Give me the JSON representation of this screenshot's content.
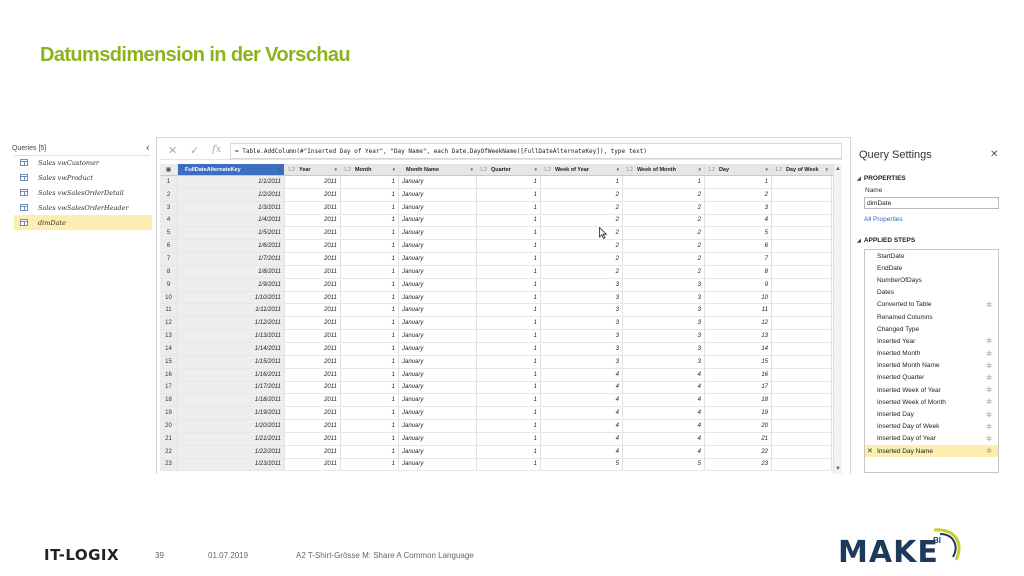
{
  "slide": {
    "title": "Datumsdimension in der Vorschau"
  },
  "queries": {
    "header": "Queries [5]",
    "collapse_icon": "chevron-left",
    "items": [
      {
        "label": "Sales vwCustomer"
      },
      {
        "label": "Sales vwProduct"
      },
      {
        "label": "Sales vwSalesOrderDetail"
      },
      {
        "label": "Sales vwSalesOrderHeader"
      },
      {
        "label": "dimDate",
        "selected": true
      }
    ]
  },
  "formula": {
    "cancel_glyph": "✕",
    "commit_glyph": "✓",
    "fx_label": "fx",
    "text": "= Table.AddColumn(#\"Inserted Day of Year\", \"Day Name\", each Date.DayOfWeekName([FullDateAlternateKey]), type text)"
  },
  "grid": {
    "columns": [
      {
        "type": "",
        "name": "FullDateAlternateKey",
        "selected": true
      },
      {
        "type": "1.2",
        "name": "Year"
      },
      {
        "type": "1.2",
        "name": "Month"
      },
      {
        "type": "",
        "name": "Month Name"
      },
      {
        "type": "1.2",
        "name": "Quarter"
      },
      {
        "type": "1.2",
        "name": "Week of Year"
      },
      {
        "type": "1.2",
        "name": "Week of Month"
      },
      {
        "type": "1.2",
        "name": "Day"
      },
      {
        "type": "1.2",
        "name": "Day of Week"
      }
    ],
    "rows": [
      [
        "1",
        "1/1/2011",
        "2011",
        "1",
        "January",
        "1",
        "1",
        "1",
        "1",
        ""
      ],
      [
        "2",
        "1/2/2011",
        "2011",
        "1",
        "January",
        "1",
        "2",
        "2",
        "2",
        ""
      ],
      [
        "3",
        "1/3/2011",
        "2011",
        "1",
        "January",
        "1",
        "2",
        "2",
        "3",
        ""
      ],
      [
        "4",
        "1/4/2011",
        "2011",
        "1",
        "January",
        "1",
        "2",
        "2",
        "4",
        ""
      ],
      [
        "5",
        "1/5/2011",
        "2011",
        "1",
        "January",
        "1",
        "2",
        "2",
        "5",
        ""
      ],
      [
        "6",
        "1/6/2011",
        "2011",
        "1",
        "January",
        "1",
        "2",
        "2",
        "6",
        ""
      ],
      [
        "7",
        "1/7/2011",
        "2011",
        "1",
        "January",
        "1",
        "2",
        "2",
        "7",
        ""
      ],
      [
        "8",
        "1/8/2011",
        "2011",
        "1",
        "January",
        "1",
        "2",
        "2",
        "8",
        ""
      ],
      [
        "9",
        "1/9/2011",
        "2011",
        "1",
        "January",
        "1",
        "3",
        "3",
        "9",
        ""
      ],
      [
        "10",
        "1/10/2011",
        "2011",
        "1",
        "January",
        "1",
        "3",
        "3",
        "10",
        ""
      ],
      [
        "11",
        "1/11/2011",
        "2011",
        "1",
        "January",
        "1",
        "3",
        "3",
        "11",
        ""
      ],
      [
        "12",
        "1/12/2011",
        "2011",
        "1",
        "January",
        "1",
        "3",
        "3",
        "12",
        ""
      ],
      [
        "13",
        "1/13/2011",
        "2011",
        "1",
        "January",
        "1",
        "3",
        "3",
        "13",
        ""
      ],
      [
        "14",
        "1/14/2011",
        "2011",
        "1",
        "January",
        "1",
        "3",
        "3",
        "14",
        ""
      ],
      [
        "15",
        "1/15/2011",
        "2011",
        "1",
        "January",
        "1",
        "3",
        "3",
        "15",
        ""
      ],
      [
        "16",
        "1/16/2011",
        "2011",
        "1",
        "January",
        "1",
        "4",
        "4",
        "16",
        ""
      ],
      [
        "17",
        "1/17/2011",
        "2011",
        "1",
        "January",
        "1",
        "4",
        "4",
        "17",
        ""
      ],
      [
        "18",
        "1/18/2011",
        "2011",
        "1",
        "January",
        "1",
        "4",
        "4",
        "18",
        ""
      ],
      [
        "19",
        "1/19/2011",
        "2011",
        "1",
        "January",
        "1",
        "4",
        "4",
        "19",
        ""
      ],
      [
        "20",
        "1/20/2011",
        "2011",
        "1",
        "January",
        "1",
        "4",
        "4",
        "20",
        ""
      ],
      [
        "21",
        "1/21/2011",
        "2011",
        "1",
        "January",
        "1",
        "4",
        "4",
        "21",
        ""
      ],
      [
        "22",
        "1/22/2011",
        "2011",
        "1",
        "January",
        "1",
        "4",
        "4",
        "22",
        ""
      ],
      [
        "23",
        "1/23/2011",
        "2011",
        "1",
        "January",
        "1",
        "5",
        "5",
        "23",
        ""
      ]
    ]
  },
  "settings": {
    "title": "Query Settings",
    "close_glyph": "✕",
    "properties_heading": "PROPERTIES",
    "name_label": "Name",
    "name_value": "dimDate",
    "all_properties_link": "All Properties",
    "steps_heading": "APPLIED STEPS",
    "steps": [
      {
        "label": "StartDate",
        "gear": false
      },
      {
        "label": "EndDate",
        "gear": false
      },
      {
        "label": "NumberOfDays",
        "gear": false
      },
      {
        "label": "Dates",
        "gear": false
      },
      {
        "label": "Converted to Table",
        "gear": true
      },
      {
        "label": "Renamed Columns",
        "gear": false
      },
      {
        "label": "Changed Type",
        "gear": false
      },
      {
        "label": "Inserted Year",
        "gear": true
      },
      {
        "label": "Inserted Month",
        "gear": true
      },
      {
        "label": "Inserted Month Name",
        "gear": true
      },
      {
        "label": "Inserted Quarter",
        "gear": true
      },
      {
        "label": "Inserted Week of Year",
        "gear": true
      },
      {
        "label": "Inserted Week of Month",
        "gear": true
      },
      {
        "label": "Inserted Day",
        "gear": true
      },
      {
        "label": "Inserted Day of Week",
        "gear": true
      },
      {
        "label": "Inserted Day of Year",
        "gear": true
      },
      {
        "label": "Inserted Day Name",
        "gear": true,
        "active": true
      }
    ]
  },
  "footer": {
    "company_logo_text": "IT-LOGIX",
    "page": "39",
    "date": "01.07.2019",
    "subtitle": "A2 T-Shirt-Grösse M: Share A Common Language",
    "brand_logo_text": "MAKE",
    "brand_logo_sup": "BI"
  },
  "colors": {
    "title_green": "#8cb31e",
    "selection_blue": "#3c6dbf",
    "highlight_yellow": "#fbeeb0",
    "brand_navy": "#1d3a5c"
  }
}
